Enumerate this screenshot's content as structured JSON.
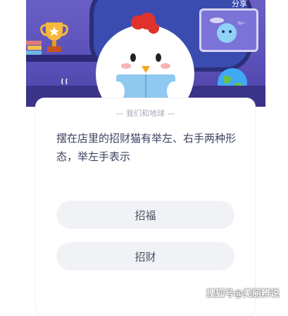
{
  "banner": {
    "screen_label": "分享"
  },
  "card": {
    "category": "— 我们和地球 —",
    "question": "摆在店里的招财猫有举左、右手两种形态，举左手表示",
    "options": [
      {
        "label": "招福"
      },
      {
        "label": "招财"
      }
    ]
  },
  "watermark": "搜狐号@美丽辨说",
  "colors": {
    "banner": "#5a4fb8",
    "option_bg": "#f1f2f5",
    "text": "#3b4160"
  }
}
